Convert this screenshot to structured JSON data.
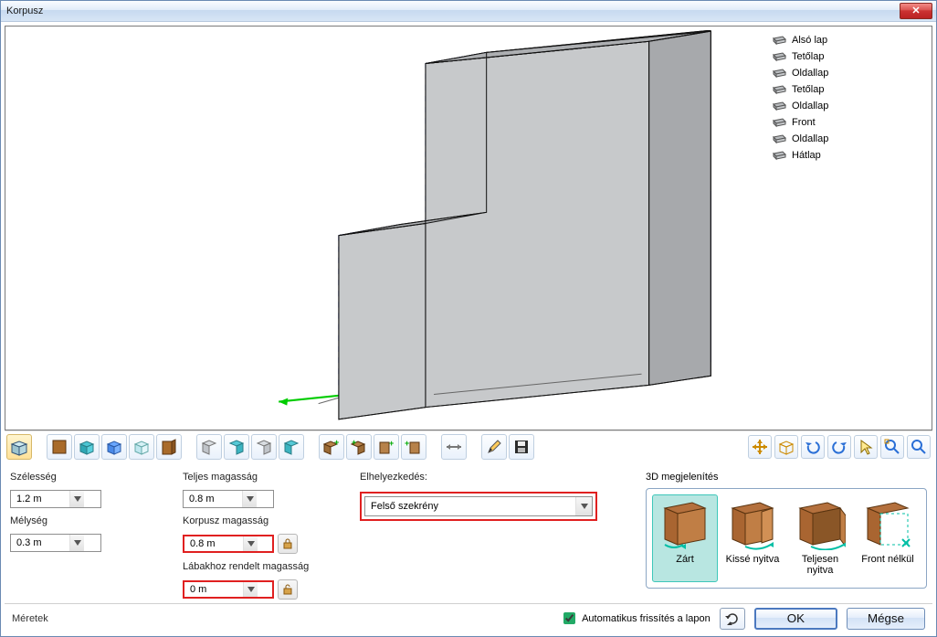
{
  "window": {
    "title": "Korpusz",
    "title_extra": ""
  },
  "parts": [
    {
      "name": "Alsó lap"
    },
    {
      "name": "Tetőlap"
    },
    {
      "name": "Oldallap"
    },
    {
      "name": "Tetőlap"
    },
    {
      "name": "Oldallap"
    },
    {
      "name": "Front"
    },
    {
      "name": "Oldallap"
    },
    {
      "name": "Hátlap"
    }
  ],
  "toolbar_left_names": [
    "base-3d",
    "front-brown",
    "3d-cyan",
    "3d-blue",
    "3d-glass",
    "panel-brown",
    "panel-3d-1",
    "panel-3d-2",
    "panel-3d-3",
    "panel-3d-4",
    "add-1",
    "add-2",
    "add-3",
    "add-4",
    "move-horiz",
    "pencil",
    "save"
  ],
  "toolbar_right_names": [
    "move-3d",
    "wire-box",
    "undo",
    "redo",
    "cursor",
    "zoom-fit",
    "zoom-in"
  ],
  "dims": {
    "width_label": "Szélesség",
    "width_value": "1.2 m",
    "depth_label": "Mélység",
    "depth_value": "0.3 m"
  },
  "heights": {
    "full_label": "Teljes magasság",
    "full_value": "0.8 m",
    "corpus_label": "Korpusz magasság",
    "corpus_value": "0.8 m",
    "legs_label": "Lábakhoz rendelt magasság",
    "legs_value": "0 m"
  },
  "placement": {
    "label": "Elhelyezkedés:",
    "value": "Felső szekrény"
  },
  "preview3d": {
    "label": "3D megjelenítés",
    "items": [
      {
        "caption": "Zárt",
        "selected": true
      },
      {
        "caption": "Kissé nyitva",
        "selected": false
      },
      {
        "caption": "Teljesen nyitva",
        "selected": false
      },
      {
        "caption": "Front nélkül",
        "selected": false
      }
    ]
  },
  "footer": {
    "left": "Méretek",
    "auto_refresh": "Automatikus frissítés a lapon",
    "ok": "OK",
    "cancel": "Mégse"
  }
}
